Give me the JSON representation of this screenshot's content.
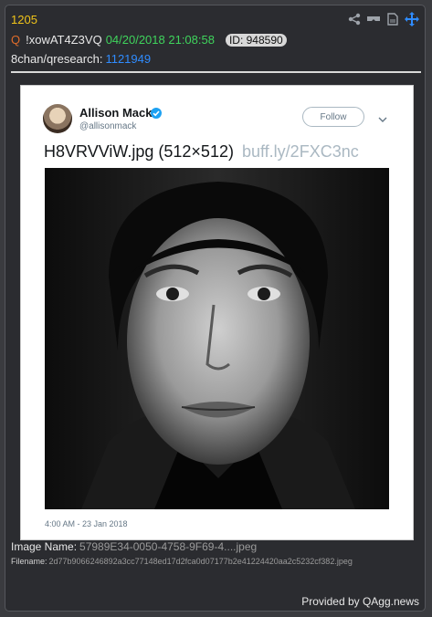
{
  "post": {
    "number": "1205",
    "q_label": "Q",
    "tripcode": "!xowAT4Z3VQ",
    "datetime": "04/20/2018 21:08:58",
    "id_badge": "ID: 948590",
    "board": "8chan/qresearch:",
    "thread_link": "1121949"
  },
  "toolbar": {
    "icons": [
      "share-icon",
      "glasses-icon",
      "document-icon",
      "move-icon"
    ]
  },
  "tweet": {
    "author_name": "Allison Mack",
    "author_handle": "@allisonmack",
    "follow_label": "Follow",
    "text": "H8VRVViW.jpg (512×512)",
    "text_link": "buff.ly/2FXC3nc",
    "timestamp": "4:00 AM - 23 Jan 2018"
  },
  "image_info": {
    "name_label": "Image Name:",
    "name_value": "57989E34-0050-4758-9F69-4....jpeg",
    "filename_label": "Filename:",
    "filename_value": "2d77b9066246892a3cc77148ed17d2fca0d07177b2e41224420aa2c5232cf382.jpeg"
  },
  "footer": {
    "provided_by": "Provided by QAgg.news"
  },
  "colors": {
    "post_number": "#f0c419",
    "date": "#3fd45c",
    "link": "#2f8cff",
    "background": "#2b2c30"
  }
}
